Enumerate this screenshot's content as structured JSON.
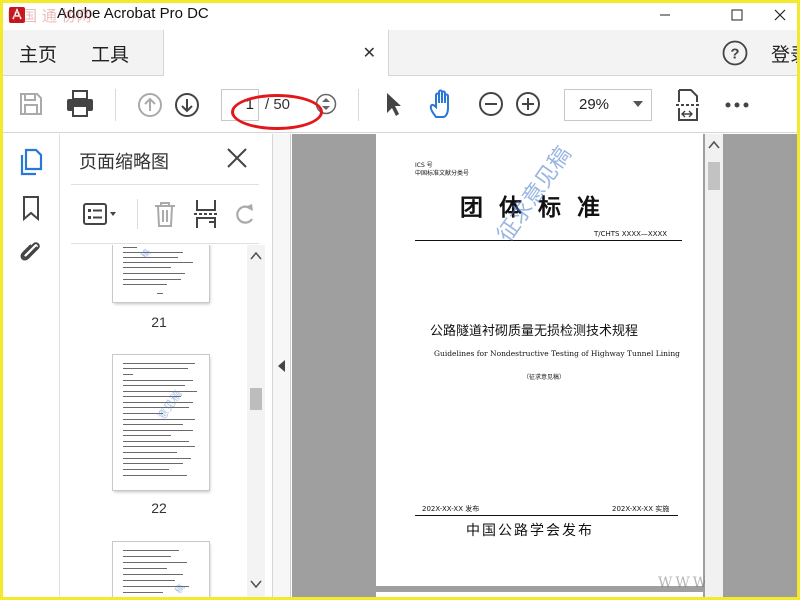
{
  "window": {
    "title": "Adobe Acrobat Pro DC",
    "overlay_watermark": "中国 通 协网"
  },
  "menu": {
    "home": "主页",
    "tools": "工具",
    "login": "登录"
  },
  "toolbar": {
    "current_page": "1",
    "total_pages": "/ 50",
    "zoom": "29%"
  },
  "thumbnails": {
    "title": "页面缩略图",
    "pages": [
      {
        "label": "21"
      },
      {
        "label": "22"
      },
      {
        "label": ""
      }
    ]
  },
  "document": {
    "ics": "ICS 号",
    "classification": "中国标准文献分类号",
    "standard_type": "团 体 标 准",
    "code": "T/CHTS XXXX—XXXX",
    "title_cn": "公路隧道衬砌质量无损检测技术规程",
    "title_en": "Guidelines for Nondestructive Testing of Highway Tunnel Lining",
    "draft_note": "（征求意见稿）",
    "issue_date": "202X-XX-XX 发布",
    "impl_date": "202X-XX-XX 实施",
    "publisher": "中国公路学会发布",
    "watermark": "征求意见稿",
    "watermark_url": "WWW"
  },
  "colors": {
    "accent_blue": "#2a78d6",
    "annotation_red": "#e4161a",
    "frame_yellow": "#f3ea2e"
  }
}
